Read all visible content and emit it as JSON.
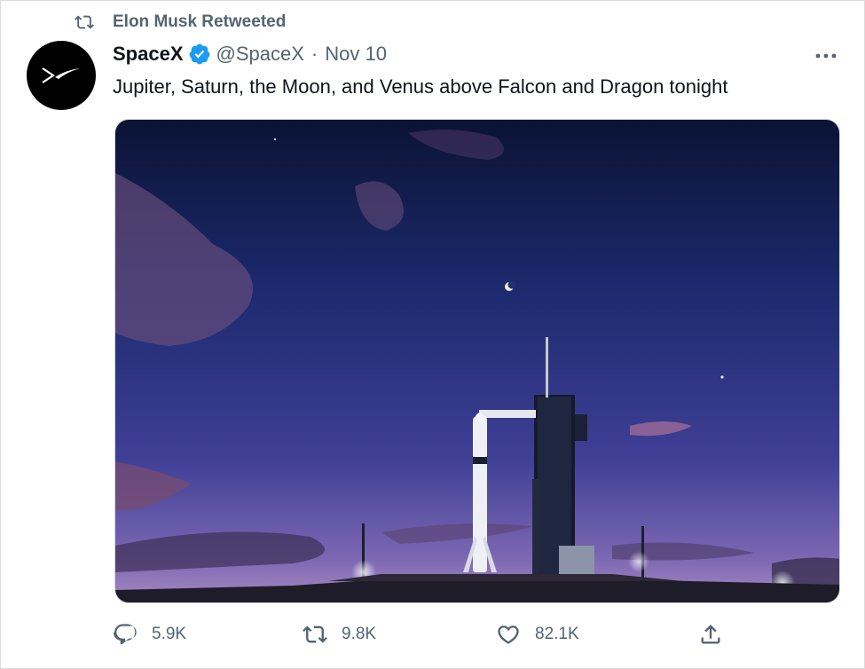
{
  "retweet_context": {
    "text": "Elon Musk Retweeted",
    "icon": "retweet-icon"
  },
  "author": {
    "display_name": "SpaceX",
    "verified": true,
    "handle": "@SpaceX",
    "separator": "·",
    "date": "Nov 10",
    "avatar_icon": "spacex-logo-icon"
  },
  "tweet": {
    "text": "Jupiter, Saturn, the Moon, and Venus above Falcon and Dragon tonight"
  },
  "actions": {
    "reply_count": "5.9K",
    "retweet_count": "9.8K",
    "like_count": "82.1K"
  },
  "colors": {
    "secondary_text": "#536471",
    "verified_blue": "#1d9bf0",
    "sky_top": "#0c1536",
    "sky_bottom": "#6a5fb0"
  }
}
